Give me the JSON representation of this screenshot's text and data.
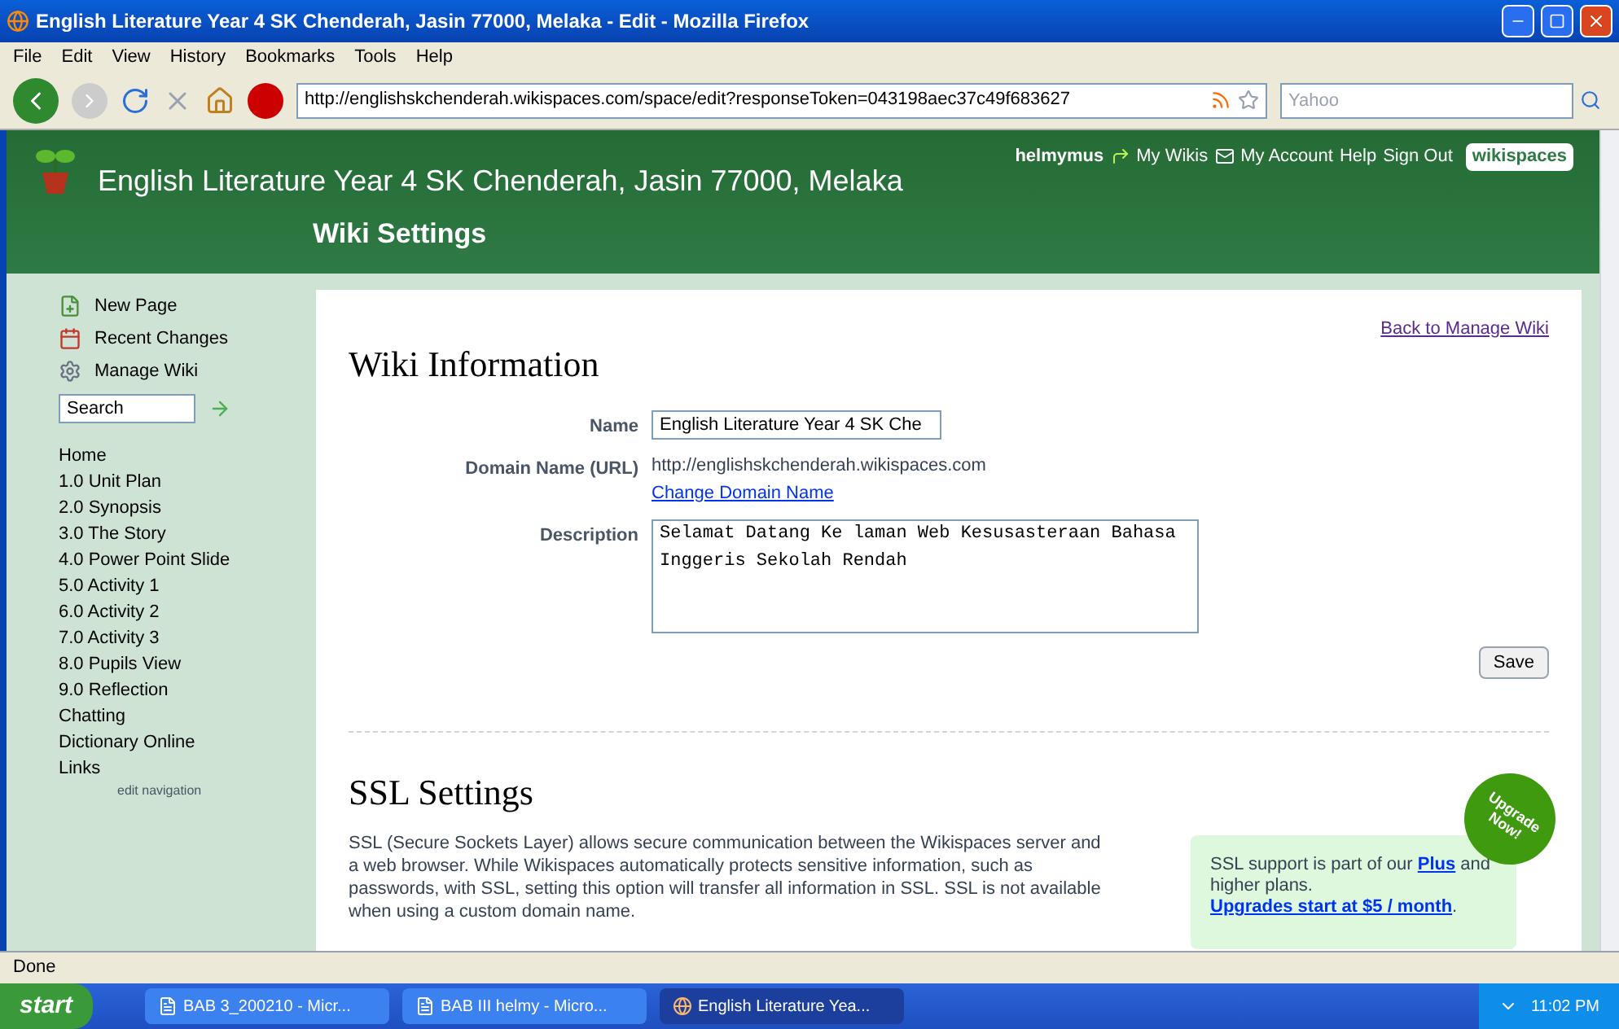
{
  "window": {
    "title": "English Literature Year 4 SK Chenderah, Jasin 77000, Melaka - Edit - Mozilla Firefox"
  },
  "menu": [
    "File",
    "Edit",
    "View",
    "History",
    "Bookmarks",
    "Tools",
    "Help"
  ],
  "toolbar": {
    "address": "http://englishskchenderah.wikispaces.com/space/edit?responseToken=043198aec37c49f683627",
    "search_placeholder": "Yahoo"
  },
  "header": {
    "site_title": "English Literature Year 4 SK Chenderah, Jasin 77000, Melaka",
    "user": "helmymus",
    "links": [
      "My Wikis",
      "My Account",
      "Help",
      "Sign Out"
    ],
    "logo": "wikispaces",
    "page_title": "Wiki Settings"
  },
  "sidebar": {
    "actions": [
      {
        "kind": "new",
        "label": "New Page"
      },
      {
        "kind": "recent",
        "label": "Recent Changes"
      },
      {
        "kind": "manage",
        "label": "Manage Wiki"
      }
    ],
    "search_value": "Search",
    "nav": [
      "Home",
      "1.0 Unit Plan",
      "2.0 Synopsis",
      "3.0 The Story",
      "4.0 Power Point Slide",
      "5.0 Activity 1",
      "6.0 Activity 2",
      "7.0 Activity 3",
      "8.0 Pupils View",
      "9.0 Reflection",
      "Chatting",
      "Dictionary Online",
      "Links"
    ],
    "edit_link": "edit navigation"
  },
  "content": {
    "back_link": "Back to Manage Wiki",
    "heading": "Wiki Information",
    "fields": [
      {
        "kind": "input",
        "label": "Name",
        "value": "English Literature Year 4 SK Che"
      },
      {
        "kind": "static",
        "label": "Domain Name (URL)",
        "value": "http://englishskchenderah.wikispaces.com",
        "link": "Change Domain Name"
      },
      {
        "kind": "textarea",
        "label": "Description",
        "value": "Selamat Datang Ke laman Web Kesusasteraan Bahasa Inggeris Sekolah Rendah"
      }
    ],
    "save": "Save",
    "ssl_heading": "SSL Settings",
    "ssl_text": "SSL (Secure Sockets Layer) allows secure communication between the Wikispaces server and a web browser. While Wikispaces automatically protects sensitive information, such as passwords, with SSL, setting this option will transfer all information in SSL. SSL is not available when using a custom domain name.",
    "promo": [
      {
        "kind": "text",
        "text": "SSL support is part of our "
      },
      {
        "kind": "link",
        "text": "Plus"
      },
      {
        "kind": "text",
        "text": " and higher plans. "
      },
      {
        "kind": "link",
        "text": "Upgrades start at $5 / month"
      },
      {
        "kind": "text",
        "text": "."
      }
    ],
    "badge": "Upgrade Now!"
  },
  "status_bar": "Done",
  "taskbar": {
    "start": "start",
    "tasks": [
      {
        "kind": "doc",
        "label": "BAB 3_200210 - Micr...",
        "selected": false
      },
      {
        "kind": "doc",
        "label": "BAB III helmy - Micro...",
        "selected": false
      },
      {
        "kind": "browser",
        "label": "English Literature Yea...",
        "selected": true
      }
    ],
    "clock": "11:02 PM"
  }
}
